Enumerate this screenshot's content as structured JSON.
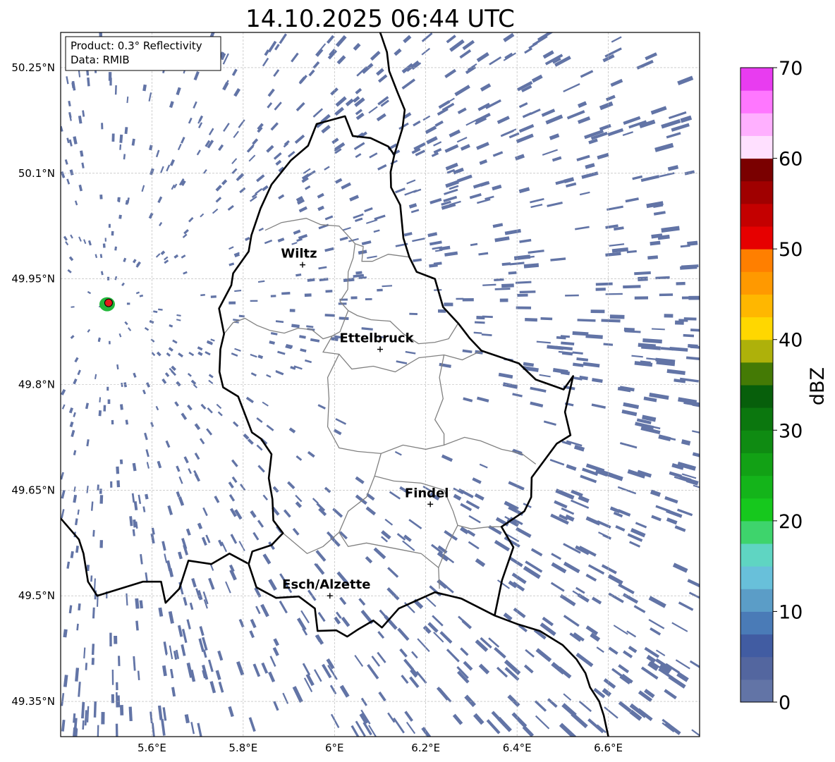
{
  "title": "14.10.2025 06:44 UTC",
  "info_box": {
    "product": "Product: 0.3° Reflectivity",
    "data": "Data: RMIB"
  },
  "axes": {
    "lon_min": 5.4,
    "lon_max": 6.8,
    "lat_min": 49.3,
    "lat_max": 50.3,
    "x_ticks": [
      {
        "value": 5.6,
        "label": "5.6°E"
      },
      {
        "value": 5.8,
        "label": "5.8°E"
      },
      {
        "value": 6.0,
        "label": "6°E"
      },
      {
        "value": 6.2,
        "label": "6.2°E"
      },
      {
        "value": 6.4,
        "label": "6.4°E"
      },
      {
        "value": 6.6,
        "label": "6.6°E"
      }
    ],
    "y_ticks": [
      {
        "value": 50.25,
        "label": "50.25°N"
      },
      {
        "value": 50.1,
        "label": "50.1°N"
      },
      {
        "value": 49.95,
        "label": "49.95°N"
      },
      {
        "value": 49.8,
        "label": "49.8°N"
      },
      {
        "value": 49.65,
        "label": "49.65°N"
      },
      {
        "value": 49.5,
        "label": "49.5°N"
      },
      {
        "value": 49.35,
        "label": "49.35°N"
      }
    ],
    "grid": true
  },
  "cities": [
    {
      "name": "Wiltz",
      "lon": 5.93,
      "lat": 49.97
    },
    {
      "name": "Ettelbruck",
      "lon": 6.1,
      "lat": 49.85
    },
    {
      "name": "Findel",
      "lon": 6.21,
      "lat": 49.63
    },
    {
      "name": "Esch/Alzette",
      "lon": 5.99,
      "lat": 49.5
    }
  ],
  "radar_site": {
    "lon": 5.505,
    "lat": 49.915
  },
  "echo_color": "#6274a6",
  "colorbar": {
    "label": "dBZ",
    "min": 0,
    "max": 70,
    "tick_values": [
      0,
      10,
      20,
      30,
      40,
      50,
      60,
      70
    ],
    "tick_labels": [
      "0",
      "10",
      "20",
      "30",
      "40",
      "50",
      "60",
      "70"
    ],
    "colors": [
      "#6274a6",
      "#53669f",
      "#415ca2",
      "#4a7bb7",
      "#5b9dc7",
      "#68c0da",
      "#5fd5c2",
      "#3ed46c",
      "#16c81d",
      "#14b41a",
      "#12a115",
      "#0f8b12",
      "#0b770e",
      "#075f0b",
      "#447a05",
      "#aeb10a",
      "#ffd700",
      "#ffb700",
      "#ff9900",
      "#ff7f00",
      "#e60000",
      "#c40000",
      "#a00000",
      "#7a0000",
      "#ffe0ff",
      "#ffb0ff",
      "#ff77ff",
      "#e83cf0"
    ]
  },
  "boundaries": {
    "country": [
      [
        6.131,
        50.126
      ],
      [
        6.149,
        50.164
      ],
      [
        6.154,
        50.19
      ],
      [
        6.138,
        50.215
      ],
      [
        6.12,
        50.245
      ],
      [
        6.115,
        50.272
      ],
      [
        6.103,
        50.295
      ],
      [
        6.1,
        50.3
      ]
    ],
    "luxembourg": [
      [
        5.812,
        49.545
      ],
      [
        5.82,
        49.563
      ],
      [
        5.862,
        49.572
      ],
      [
        5.887,
        49.589
      ],
      [
        5.866,
        49.607
      ],
      [
        5.864,
        49.637
      ],
      [
        5.856,
        49.667
      ],
      [
        5.862,
        49.701
      ],
      [
        5.839,
        49.723
      ],
      [
        5.819,
        49.732
      ],
      [
        5.789,
        49.783
      ],
      [
        5.756,
        49.796
      ],
      [
        5.748,
        49.818
      ],
      [
        5.75,
        49.85
      ],
      [
        5.758,
        49.872
      ],
      [
        5.747,
        49.908
      ],
      [
        5.774,
        49.941
      ],
      [
        5.778,
        49.958
      ],
      [
        5.812,
        49.989
      ],
      [
        5.818,
        50.012
      ],
      [
        5.838,
        50.05
      ],
      [
        5.862,
        50.084
      ],
      [
        5.904,
        50.118
      ],
      [
        5.942,
        50.139
      ],
      [
        5.961,
        50.17
      ],
      [
        6.023,
        50.181
      ],
      [
        6.04,
        50.153
      ],
      [
        6.079,
        50.15
      ],
      [
        6.118,
        50.138
      ],
      [
        6.131,
        50.126
      ],
      [
        6.123,
        50.102
      ],
      [
        6.124,
        50.08
      ],
      [
        6.144,
        50.055
      ],
      [
        6.151,
        50.008
      ],
      [
        6.164,
        49.981
      ],
      [
        6.18,
        49.96
      ],
      [
        6.22,
        49.95
      ],
      [
        6.238,
        49.91
      ],
      [
        6.271,
        49.887
      ],
      [
        6.296,
        49.866
      ],
      [
        6.322,
        49.848
      ],
      [
        6.404,
        49.83
      ],
      [
        6.441,
        49.807
      ],
      [
        6.502,
        49.793
      ],
      [
        6.523,
        49.812
      ],
      [
        6.505,
        49.761
      ],
      [
        6.517,
        49.728
      ],
      [
        6.487,
        49.716
      ],
      [
        6.432,
        49.668
      ],
      [
        6.431,
        49.64
      ],
      [
        6.416,
        49.62
      ],
      [
        6.366,
        49.598
      ],
      [
        6.392,
        49.569
      ],
      [
        6.367,
        49.522
      ],
      [
        6.351,
        49.472
      ],
      [
        6.278,
        49.496
      ],
      [
        6.22,
        49.505
      ],
      [
        6.141,
        49.482
      ],
      [
        6.104,
        49.455
      ],
      [
        6.085,
        49.465
      ],
      [
        6.051,
        49.452
      ],
      [
        6.028,
        49.442
      ],
      [
        6.004,
        49.451
      ],
      [
        5.963,
        49.45
      ],
      [
        5.957,
        49.482
      ],
      [
        5.922,
        49.499
      ],
      [
        5.872,
        49.497
      ],
      [
        5.829,
        49.512
      ],
      [
        5.812,
        49.545
      ]
    ],
    "belgium_south": [
      [
        5.4,
        49.61
      ],
      [
        5.44,
        49.58
      ],
      [
        5.45,
        49.56
      ],
      [
        5.46,
        49.52
      ],
      [
        5.48,
        49.5
      ],
      [
        5.53,
        49.51
      ],
      [
        5.58,
        49.52
      ],
      [
        5.62,
        49.52
      ],
      [
        5.63,
        49.49
      ],
      [
        5.66,
        49.51
      ],
      [
        5.68,
        49.55
      ],
      [
        5.73,
        49.545
      ],
      [
        5.77,
        49.56
      ],
      [
        5.81,
        49.546
      ]
    ],
    "france_germany": [
      [
        6.351,
        49.472
      ],
      [
        6.4,
        49.46
      ],
      [
        6.45,
        49.45
      ],
      [
        6.5,
        49.43
      ],
      [
        6.53,
        49.41
      ],
      [
        6.55,
        49.39
      ],
      [
        6.56,
        49.37
      ],
      [
        6.58,
        49.35
      ],
      [
        6.59,
        49.33
      ],
      [
        6.6,
        49.3
      ]
    ],
    "cantons": [
      [
        [
          5.848,
          50.019
        ],
        [
          5.884,
          50.03
        ],
        [
          5.938,
          50.036
        ],
        [
          5.97,
          50.027
        ],
        [
          6.01,
          50.025
        ],
        [
          6.03,
          50.011
        ],
        [
          6.045,
          50.0
        ],
        [
          6.063,
          49.996
        ],
        [
          6.06,
          49.975
        ],
        [
          6.083,
          49.975
        ],
        [
          6.118,
          49.985
        ],
        [
          6.164,
          49.981
        ]
      ],
      [
        [
          6.045,
          50.0
        ],
        [
          6.041,
          49.98
        ],
        [
          6.03,
          49.96
        ],
        [
          6.029,
          49.935
        ],
        [
          6.012,
          49.918
        ],
        [
          6.03,
          49.905
        ],
        [
          6.05,
          49.898
        ],
        [
          6.08,
          49.892
        ],
        [
          6.122,
          49.89
        ],
        [
          6.151,
          49.872
        ],
        [
          6.184,
          49.858
        ],
        [
          6.22,
          49.86
        ],
        [
          6.25,
          49.865
        ],
        [
          6.271,
          49.887
        ]
      ],
      [
        [
          5.758,
          49.872
        ],
        [
          5.778,
          49.888
        ],
        [
          5.804,
          49.894
        ],
        [
          5.83,
          49.884
        ],
        [
          5.858,
          49.877
        ],
        [
          5.89,
          49.873
        ],
        [
          5.92,
          49.88
        ],
        [
          5.95,
          49.878
        ],
        [
          5.975,
          49.865
        ],
        [
          5.995,
          49.869
        ],
        [
          6.012,
          49.875
        ],
        [
          6.03,
          49.905
        ]
      ],
      [
        [
          5.995,
          49.869
        ],
        [
          5.975,
          49.846
        ],
        [
          6.01,
          49.843
        ],
        [
          6.038,
          49.822
        ],
        [
          6.085,
          49.826
        ],
        [
          6.133,
          49.818
        ],
        [
          6.185,
          49.838
        ],
        [
          6.24,
          49.842
        ],
        [
          6.28,
          49.835
        ],
        [
          6.322,
          49.848
        ]
      ],
      [
        [
          6.01,
          49.843
        ],
        [
          5.985,
          49.81
        ],
        [
          5.988,
          49.78
        ],
        [
          5.985,
          49.74
        ],
        [
          6.01,
          49.71
        ],
        [
          6.05,
          49.705
        ],
        [
          6.102,
          49.702
        ],
        [
          6.15,
          49.714
        ],
        [
          6.2,
          49.708
        ],
        [
          6.24,
          49.714
        ],
        [
          6.285,
          49.725
        ],
        [
          6.32,
          49.72
        ],
        [
          6.366,
          49.708
        ],
        [
          6.41,
          49.702
        ],
        [
          6.441,
          49.687
        ]
      ],
      [
        [
          6.24,
          49.842
        ],
        [
          6.23,
          49.81
        ],
        [
          6.238,
          49.78
        ],
        [
          6.22,
          49.75
        ],
        [
          6.24,
          49.73
        ],
        [
          6.24,
          49.714
        ]
      ],
      [
        [
          6.102,
          49.702
        ],
        [
          6.088,
          49.67
        ],
        [
          6.07,
          49.64
        ],
        [
          6.03,
          49.62
        ],
        [
          6.01,
          49.59
        ],
        [
          5.975,
          49.57
        ],
        [
          5.94,
          49.56
        ],
        [
          5.887,
          49.589
        ]
      ],
      [
        [
          6.088,
          49.67
        ],
        [
          6.13,
          49.663
        ],
        [
          6.19,
          49.66
        ],
        [
          6.24,
          49.65
        ],
        [
          6.26,
          49.62
        ],
        [
          6.27,
          49.6
        ],
        [
          6.3,
          49.595
        ],
        [
          6.34,
          49.598
        ],
        [
          6.366,
          49.598
        ]
      ],
      [
        [
          6.27,
          49.6
        ],
        [
          6.25,
          49.575
        ],
        [
          6.228,
          49.54
        ],
        [
          6.23,
          49.51
        ]
      ],
      [
        [
          6.01,
          49.59
        ],
        [
          6.03,
          49.57
        ],
        [
          6.07,
          49.575
        ],
        [
          6.11,
          49.57
        ],
        [
          6.15,
          49.565
        ],
        [
          6.19,
          49.56
        ],
        [
          6.228,
          49.54
        ]
      ]
    ]
  }
}
